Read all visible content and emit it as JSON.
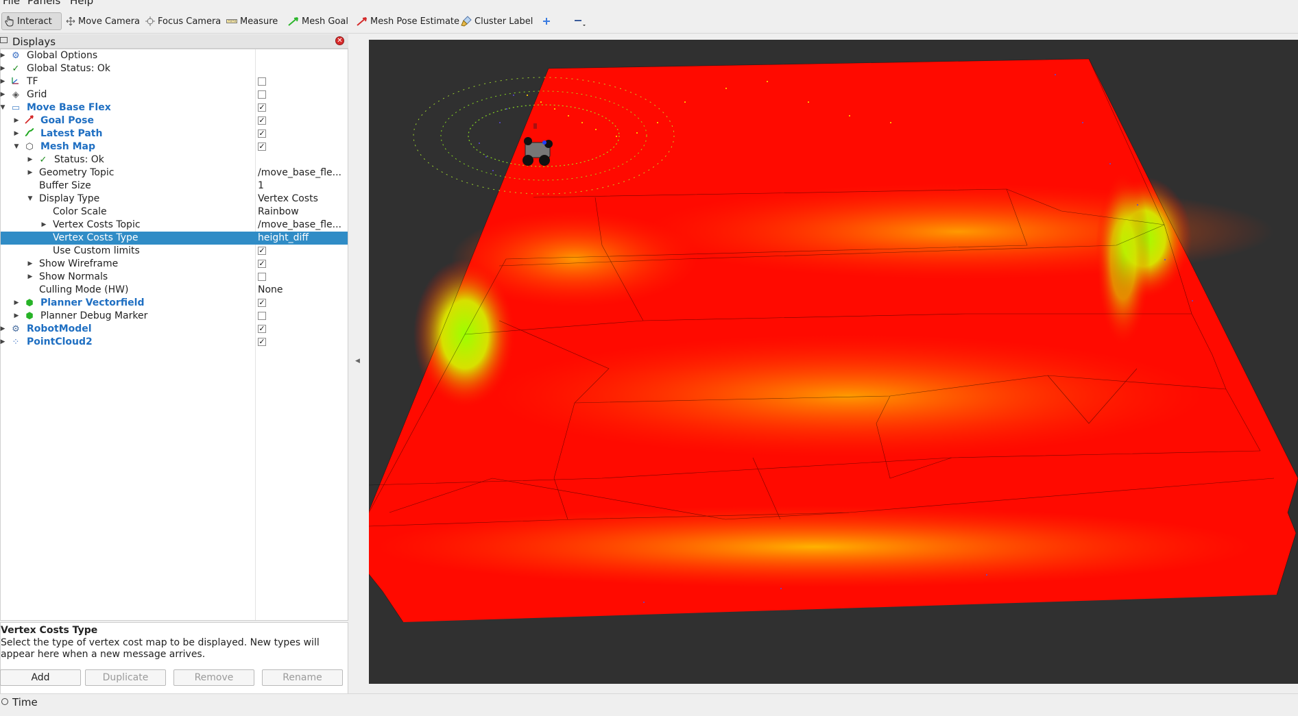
{
  "menu": [
    "File",
    "Panels",
    "Help"
  ],
  "toolbar": {
    "interact": "Interact",
    "move_camera": "Move Camera",
    "focus_camera": "Focus Camera",
    "measure": "Measure",
    "mesh_goal": "Mesh Goal",
    "mesh_pose_estimate": "Mesh Pose Estimate",
    "cluster_label": "Cluster Label",
    "add_icon": "plus-icon",
    "remove_icon": "minus-icon"
  },
  "displays": {
    "title": "Displays",
    "tree": [
      {
        "label": "Global Options",
        "icon": "gear-icon",
        "expanded": false
      },
      {
        "label": "Global Status: Ok",
        "icon": "check-icon",
        "expanded": false
      },
      {
        "label": "TF",
        "icon": "tf-icon",
        "expanded": false,
        "checked": false
      },
      {
        "label": "Grid",
        "icon": "grid-icon",
        "expanded": false,
        "checked": false
      },
      {
        "label": "Move Base Flex",
        "icon": "folder-icon",
        "expanded": true,
        "checked": true
      },
      {
        "label": "Goal Pose",
        "icon": "pose-arrow-icon",
        "expanded": false,
        "checked": true
      },
      {
        "label": "Latest Path",
        "icon": "path-icon",
        "expanded": false,
        "checked": true
      },
      {
        "label": "Mesh Map",
        "icon": "mesh-icon",
        "expanded": true,
        "checked": true
      },
      {
        "label": "Status: Ok",
        "icon": "check-icon",
        "expanded": false
      },
      {
        "label": "Geometry Topic",
        "value": "/move_base_fle..."
      },
      {
        "label": "Buffer Size",
        "value": "1"
      },
      {
        "label": "Display Type",
        "value": "Vertex Costs",
        "expanded": true
      },
      {
        "label": "Color Scale",
        "value": "Rainbow"
      },
      {
        "label": "Vertex Costs Topic",
        "value": "/move_base_fle...",
        "expanded": false
      },
      {
        "label": "Vertex Costs Type",
        "value": "height_diff",
        "selected": true
      },
      {
        "label": "Use Custom limits",
        "checked": true
      },
      {
        "label": "Show Wireframe",
        "expanded": false,
        "checked": true
      },
      {
        "label": "Show Normals",
        "expanded": false,
        "checked": false
      },
      {
        "label": "Culling Mode (HW)",
        "value": "None"
      },
      {
        "label": "Planner Vectorfield",
        "icon": "green-cube-icon",
        "expanded": false,
        "checked": true
      },
      {
        "label": "Planner Debug Marker",
        "icon": "green-cube-icon",
        "expanded": false,
        "checked": false
      },
      {
        "label": "RobotModel",
        "icon": "robot-icon",
        "expanded": false,
        "checked": true
      },
      {
        "label": "PointCloud2",
        "icon": "pointcloud-icon",
        "expanded": false,
        "checked": true
      }
    ],
    "description": {
      "title": "Vertex Costs Type",
      "text": "Select the type of vertex cost map to be displayed. New types will appear here when a new message arrives."
    },
    "buttons": {
      "add": "Add",
      "duplicate": "Duplicate",
      "remove": "Remove",
      "rename": "Rename"
    }
  },
  "time_panel": {
    "title": "Time"
  },
  "colors": {
    "selection": "#308cc6",
    "link_blue": "#1f6fc2",
    "viewport_bg": "#303030",
    "cost_low": "#7fff00",
    "cost_high": "#ff0000"
  }
}
